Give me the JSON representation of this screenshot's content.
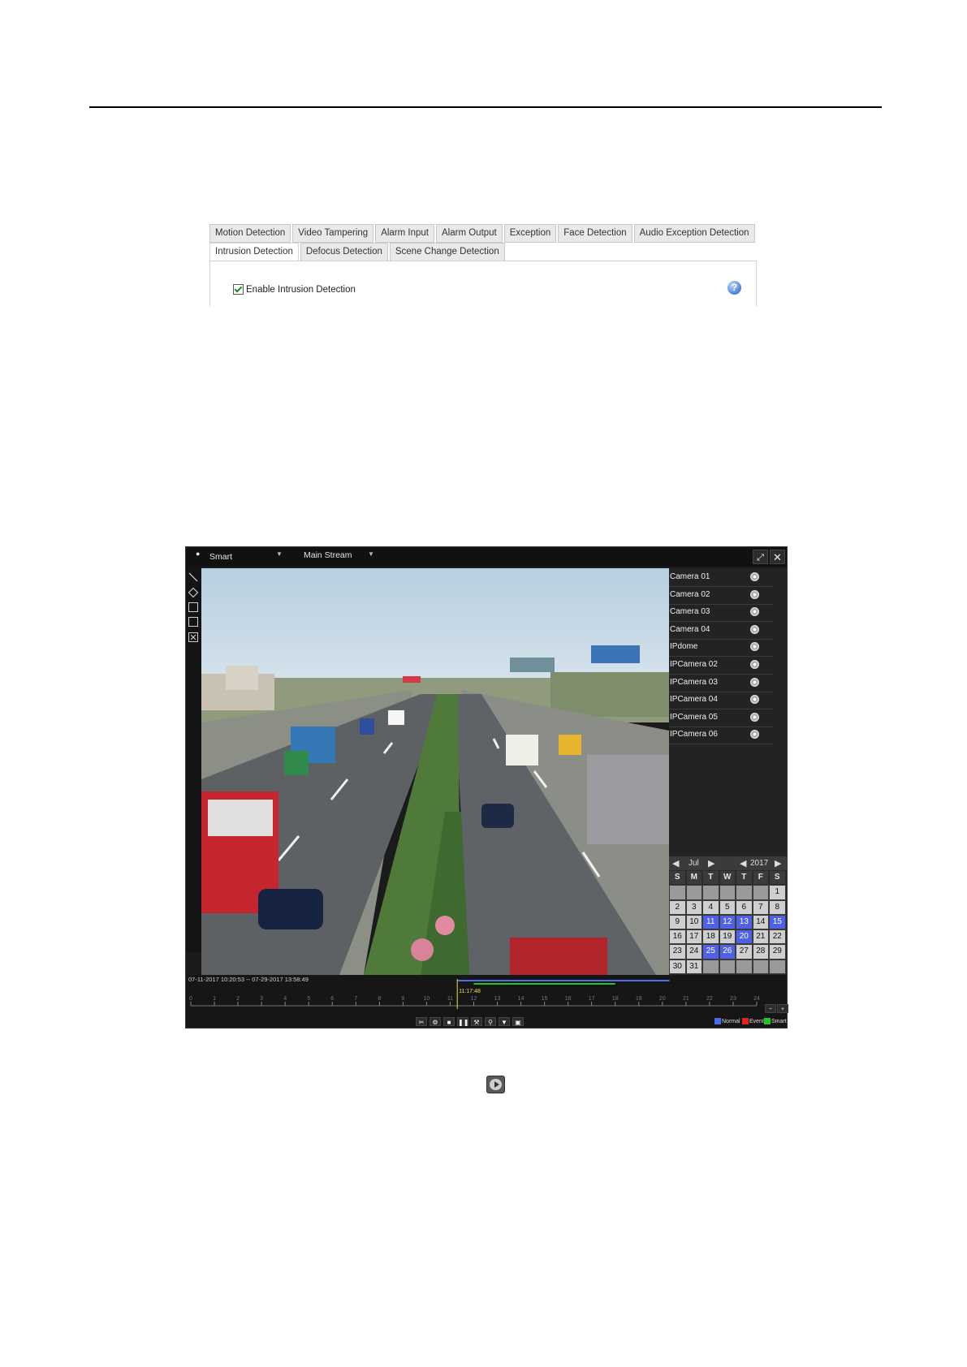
{
  "tabs": {
    "row1": [
      "Motion Detection",
      "Video Tampering",
      "Alarm Input",
      "Alarm Output",
      "Exception",
      "Face Detection",
      "Audio Exception Detection"
    ],
    "row2": [
      "Intrusion Detection",
      "Defocus Detection",
      "Scene Change Detection"
    ],
    "active": "Intrusion Detection",
    "enable_label": "Enable Intrusion Detection",
    "enable_checked": true,
    "help_glyph": "?"
  },
  "player": {
    "mode": "Smart",
    "stream": "Main Stream",
    "cameras": [
      "Camera 01",
      "Camera 02",
      "Camera 03",
      "Camera 04",
      "IPdome",
      "IPCamera 02",
      "IPCamera 03",
      "IPCamera 04",
      "IPCamera 05",
      "IPCamera 06"
    ],
    "calendar": {
      "month": "Jul",
      "year": "2017",
      "weekdays": [
        "S",
        "M",
        "T",
        "W",
        "T",
        "F",
        "S"
      ],
      "first_weekday_index": 6,
      "days_in_month": 31,
      "highlighted_days": [
        11,
        12,
        13,
        15,
        20,
        25,
        26
      ]
    },
    "timeline": {
      "range": "07-11-2017 10:20:53 -- 07-29-2017 13:58:49",
      "cursor_time": "11:17:48",
      "hours": [
        "0",
        "1",
        "2",
        "3",
        "4",
        "5",
        "6",
        "7",
        "8",
        "9",
        "10",
        "11",
        "12",
        "13",
        "14",
        "15",
        "16",
        "17",
        "18",
        "19",
        "20",
        "21",
        "22",
        "23",
        "24"
      ]
    },
    "legend": [
      "Normal",
      "Event",
      "Smart"
    ],
    "legend_colors": [
      "#4a6cf0",
      "#e02424",
      "#23c423"
    ]
  },
  "colors": {
    "calendar_highlight": "#4f62e6",
    "record_bar_blue": "#4a6cf0",
    "record_bar_green": "#23c423",
    "cursor_yellow": "#e8e24a"
  }
}
